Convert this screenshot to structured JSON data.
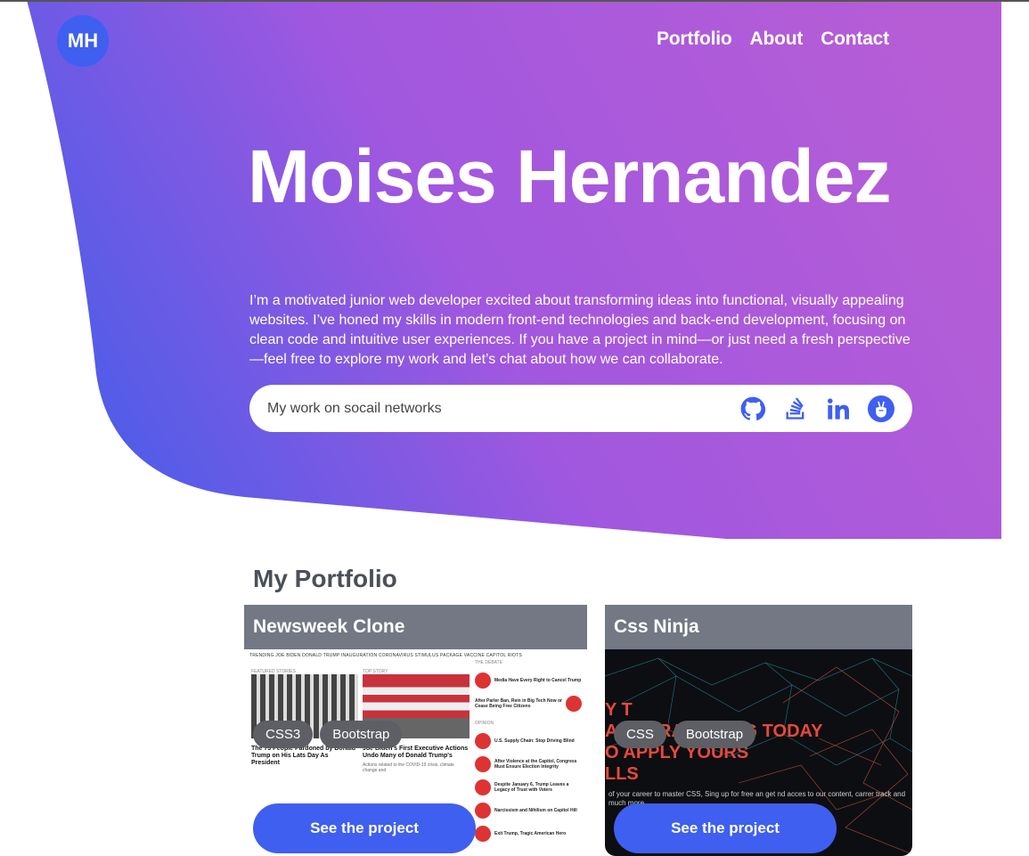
{
  "header": {
    "logo": "MH",
    "nav": [
      "Portfolio",
      "About",
      "Contact"
    ]
  },
  "hero": {
    "title": "Moises Hernandez",
    "description": "I’m a motivated junior web developer excited about transforming ideas into functional, visually appealing websites. I’ve honed my skills in modern front-end technologies and back-end development, focusing on clean code and intuitive user experiences. If you have a project in mind—or just need a fresh perspective—feel free to explore my work and let’s chat about how we can collaborate.",
    "social_label": "My work on socail networks",
    "social_icons": [
      "github-icon",
      "stackoverflow-icon",
      "linkedin-icon",
      "angellist-icon"
    ]
  },
  "portfolio": {
    "title": "My Portfolio",
    "projects": [
      {
        "title": "Newsweek Clone",
        "tags": [
          "CSS3",
          "Bootstrap"
        ],
        "cta": "See the project",
        "screenshot": {
          "trending": "TRENDING   JOE BIDEN   DONALD TRUMP   INAUGURATION   CORONAVIRUS   STIMULUS PACKAGE   VACCINE   CAPITOL RIOTS",
          "featured_label": "FEATURED STORIES",
          "featured_headline": "The 73 People Pardoned by Donald Trump on His Lats Day As President",
          "top_label": "TOP STORY",
          "top_headline": "Joe Biden's First Executive Actions Undo Many of Donald Trump's",
          "top_summary": "Actions related to the COVID-19 crisis, climate change and",
          "debate_label": "THE DEBATE",
          "debate_items": [
            "Media Have Every Right to Cancel Trump",
            "After Parler Ban, Rein in Big Tech Now or Cease Being Free Citizens"
          ],
          "opinion_label": "OPINION",
          "opinion_items": [
            "U.S. Supply Chain: Stop Driving Blind",
            "After Violence at the Capitol, Congress Must Ensure Election Integrity",
            "Despite January 6, Trump Leaves a Legacy of Trust with Voters",
            "Narcissism and Nihilism on Capitol Hill",
            "Exit Trump, Tragic American Hero"
          ]
        }
      },
      {
        "title": "Css Ninja",
        "tags": [
          "CSS",
          "Bootstrap"
        ],
        "cta": "See the project",
        "screenshot": {
          "lines": [
            "Y T",
            "ART PRACTICING TODAY",
            "O APPLY YOURS",
            "LLS"
          ],
          "sub": "of your career to master CSS, Sing up for free an get nd acces to our content, carrer track and much more."
        }
      }
    ]
  },
  "colors": {
    "hero_gradient_start": "#4a5de9",
    "hero_gradient_end": "#b65dd6",
    "accent": "#3f5ff0",
    "card_header": "#737884"
  }
}
